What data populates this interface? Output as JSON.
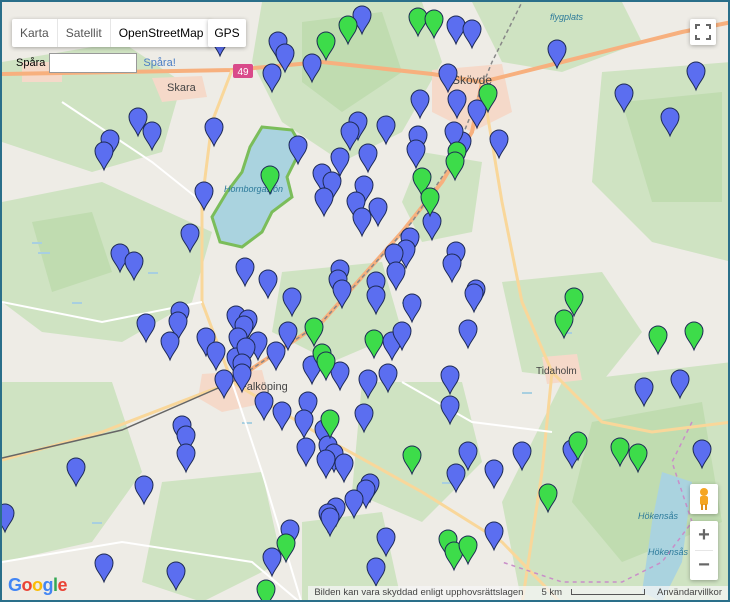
{
  "map_types": [
    "Karta",
    "Satellit",
    "OpenStreetMap"
  ],
  "active_map_type": "OpenStreetMap",
  "gps_label": "GPS",
  "track": {
    "label": "Spåra",
    "value": "",
    "link": "Spåra!"
  },
  "places": [
    {
      "name": "Skara"
    },
    {
      "name": "Skövde"
    },
    {
      "name": "Hornborgasjön"
    },
    {
      "name": "Falköping"
    },
    {
      "name": "Tidaholm"
    },
    {
      "name": "Hökensås"
    },
    {
      "name": "Hökensås"
    },
    {
      "name": "flygplats"
    }
  ],
  "road_shield": "49",
  "attribution": {
    "copyright": "Bilden kan vara skyddad enligt upphovsrättslagen",
    "scale": "5 km",
    "terms": "Användarvillkor"
  },
  "logo": "Google",
  "marker_colors": {
    "blue": "#5b6ef0",
    "green": "#3ddc4a"
  },
  "markers_blue": 150,
  "markers_green": 28
}
